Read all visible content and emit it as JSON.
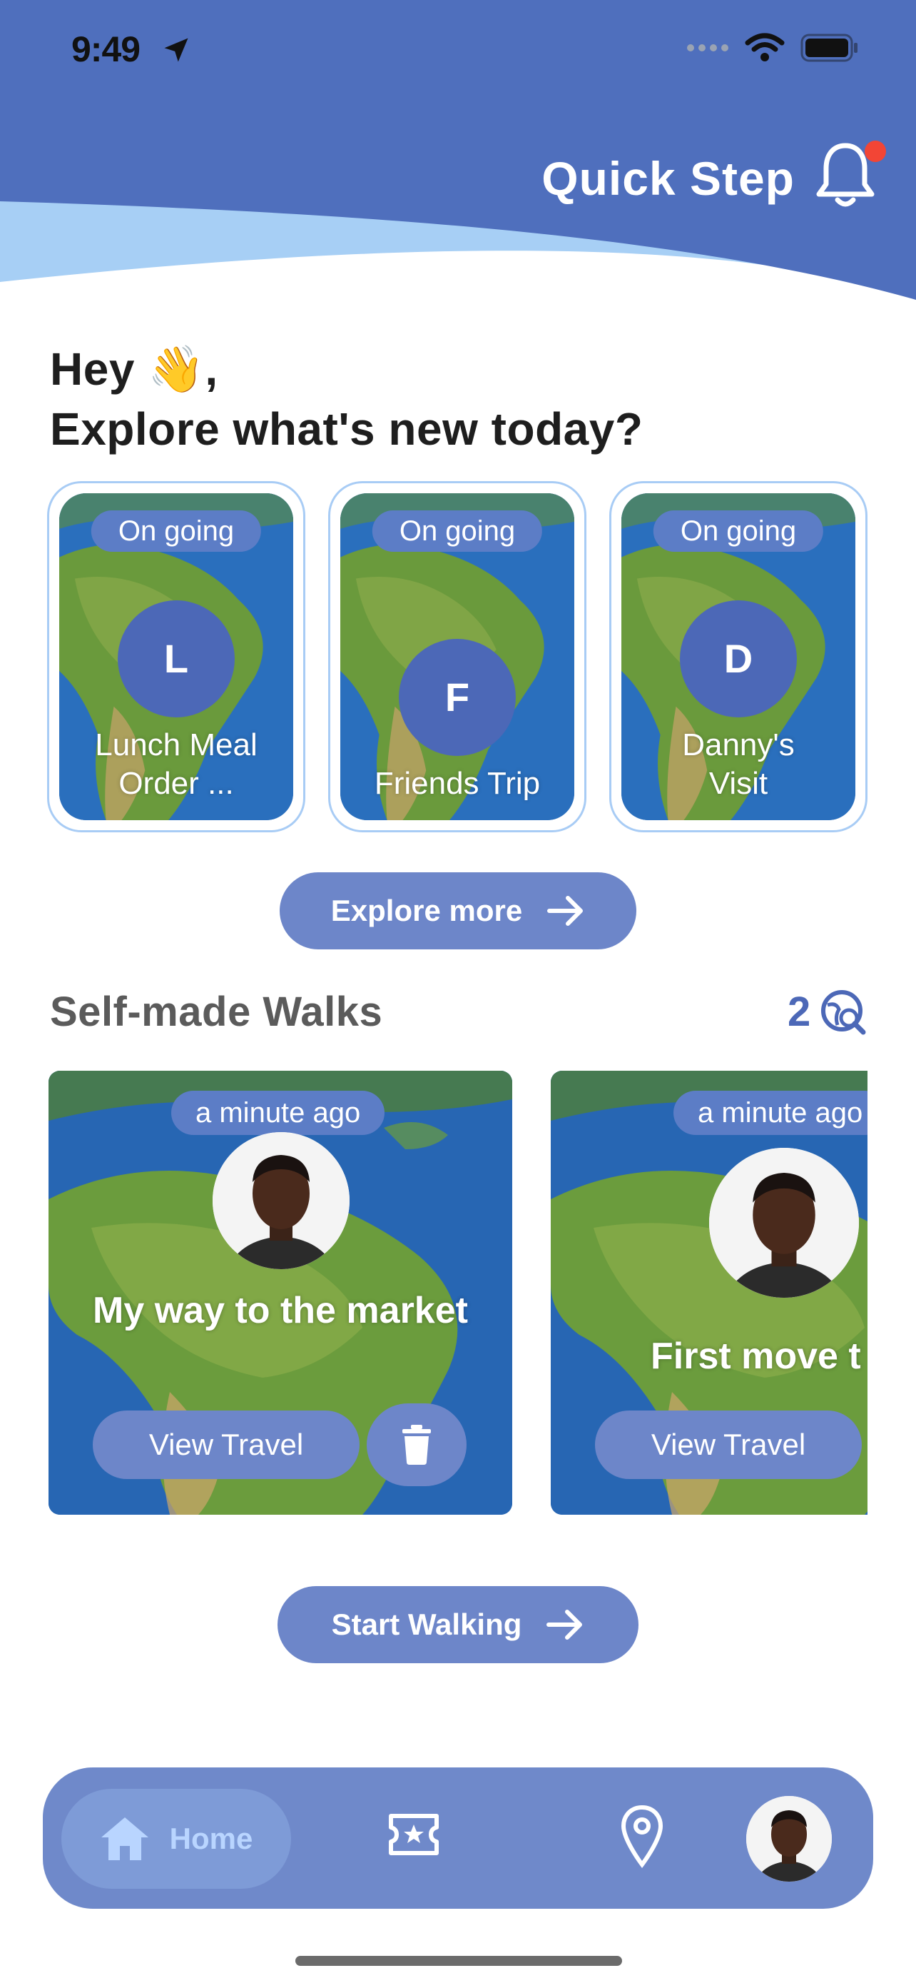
{
  "status_bar": {
    "time": "9:49",
    "icons": [
      "location-arrow-icon",
      "signal-dots-icon",
      "wifi-icon",
      "battery-icon"
    ]
  },
  "header": {
    "title": "Quick Step",
    "notification_icon": "bell-icon",
    "has_unread_notification": true,
    "colors": {
      "primary": "#4f6fbd",
      "wave_light": "#a7cff5",
      "dot": "#f24535"
    }
  },
  "greeting": {
    "line1": "Hey 👋,",
    "line2": "Explore what's new today?"
  },
  "ongoing": [
    {
      "status": "On going",
      "initial": "L",
      "title": "Lunch Meal Order ..."
    },
    {
      "status": "On going",
      "initial": "F",
      "title": "Friends Trip"
    },
    {
      "status": "On going",
      "initial": "D",
      "title": "Danny's Visit"
    }
  ],
  "explore_button": {
    "label": "Explore more",
    "icon": "arrow-right-icon"
  },
  "self_made": {
    "title": "Self-made Walks",
    "count": "2",
    "icon": "globe-search-icon",
    "walks": [
      {
        "time": "a minute ago",
        "title": "My way to the market",
        "action": "View Travel",
        "delete_icon": "trash-icon"
      },
      {
        "time": "a minute ago",
        "title": "First move t",
        "action": "View Travel"
      }
    ]
  },
  "start_button": {
    "label": "Start Walking",
    "icon": "arrow-right-icon"
  },
  "bottom_nav": {
    "items": [
      {
        "label": "Home",
        "icon": "home-icon",
        "active": true
      },
      {
        "label": "",
        "icon": "ticket-star-icon",
        "active": false
      },
      {
        "label": "",
        "icon": "map-pin-icon",
        "active": false
      },
      {
        "label": "",
        "icon": "profile-avatar",
        "active": false
      }
    ]
  }
}
